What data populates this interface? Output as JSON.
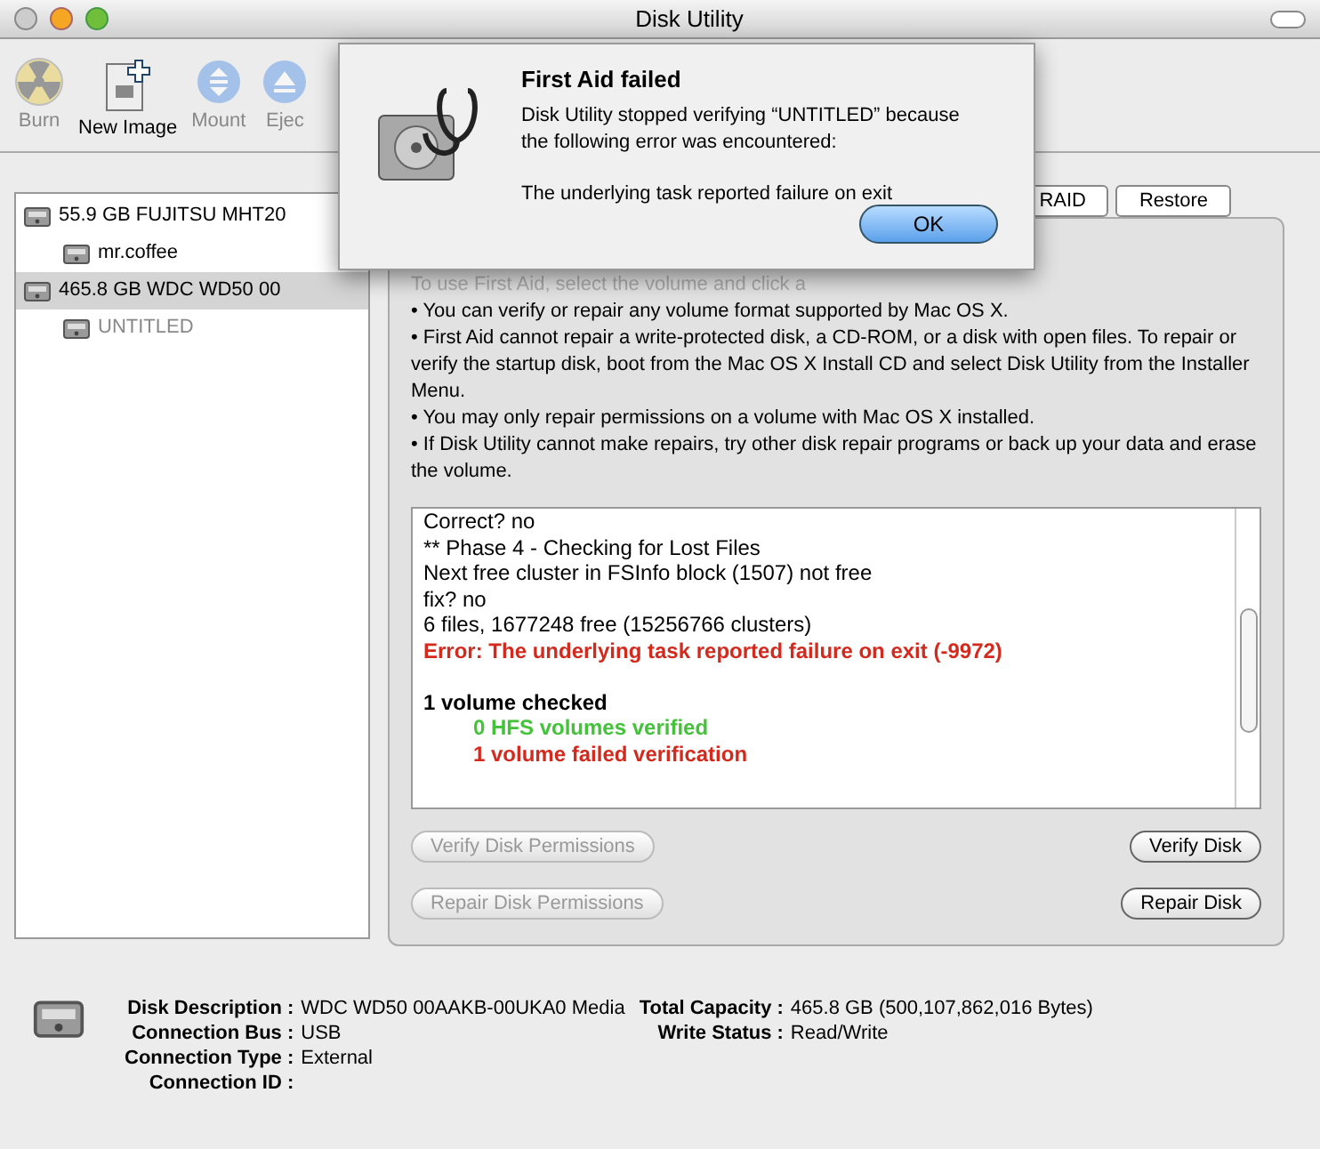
{
  "window": {
    "title": "Disk Utility"
  },
  "toolbar": [
    {
      "label": "Burn",
      "kind": "burn",
      "disabled": true
    },
    {
      "label": "New Image",
      "kind": "image",
      "disabled": false
    },
    {
      "label": "Mount",
      "kind": "mount",
      "disabled": true
    },
    {
      "label": "Ejec",
      "kind": "eject",
      "disabled": true
    }
  ],
  "sidebar": {
    "items": [
      {
        "label": "55.9 GB FUJITSU MHT20",
        "selected": false,
        "dimmed": false,
        "children": [
          {
            "label": "mr.coffee",
            "selected": false,
            "dimmed": false
          }
        ]
      },
      {
        "label": "465.8 GB WDC WD50 00",
        "selected": true,
        "dimmed": false,
        "children": [
          {
            "label": "UNTITLED",
            "selected": false,
            "dimmed": true
          }
        ]
      }
    ]
  },
  "tabs": [
    {
      "label": "RAID"
    },
    {
      "label": "Restore"
    }
  ],
  "instructions": {
    "intro": "To use First Aid, select the volume and click a",
    "bullets": [
      "• You can verify or repair any volume format supported by Mac OS X.",
      "• First Aid cannot repair a write-protected disk, a CD-ROM, or a disk with open files. To repair or verify the startup disk, boot from the Mac OS X Install CD and select Disk Utility from the Installer Menu.",
      "• You may only repair permissions on a volume with Mac OS X installed.",
      "• If Disk Utility cannot make repairs, try other disk repair programs or back up your data and erase the volume."
    ]
  },
  "log": [
    {
      "text": "Correct? no",
      "kind": "plain"
    },
    {
      "text": "** Phase 4 - Checking for Lost Files",
      "kind": "plain"
    },
    {
      "text": "Next free cluster in FSInfo block (1507) not free",
      "kind": "plain"
    },
    {
      "text": "fix? no",
      "kind": "plain"
    },
    {
      "text": "6 files, 1677248 free (15256766 clusters)",
      "kind": "plain"
    },
    {
      "text": "Error: The underlying task reported failure on exit (-9972)",
      "kind": "error"
    },
    {
      "text": "1 volume checked",
      "kind": "heading"
    },
    {
      "text": "0 HFS volumes verified",
      "kind": "ok"
    },
    {
      "text": "1 volume failed verification",
      "kind": "failed"
    }
  ],
  "buttons": [
    {
      "label": "Verify Disk Permissions",
      "disabled": true
    },
    {
      "label": "Verify Disk",
      "disabled": false
    },
    {
      "label": "Repair Disk Permissions",
      "disabled": true
    },
    {
      "label": "Repair Disk",
      "disabled": false
    }
  ],
  "info": {
    "left": [
      {
        "label": "Disk Description :",
        "value": "WDC WD50 00AAKB-00UKA0 Media"
      },
      {
        "label": "Connection Bus :",
        "value": "USB"
      },
      {
        "label": "Connection Type :",
        "value": "External"
      },
      {
        "label": "Connection ID :"
      }
    ],
    "right": [
      {
        "label": "Total Capacity :",
        "value": "465.8 GB (500,107,862,016 Bytes)"
      },
      {
        "label": "Write Status :",
        "value": "Read/Write"
      }
    ]
  },
  "dialog": {
    "title": "First Aid failed",
    "message": "Disk Utility stopped verifying “UNTITLED” because the following error was encountered:",
    "detail": "The underlying task reported failure on exit",
    "button": "OK"
  }
}
